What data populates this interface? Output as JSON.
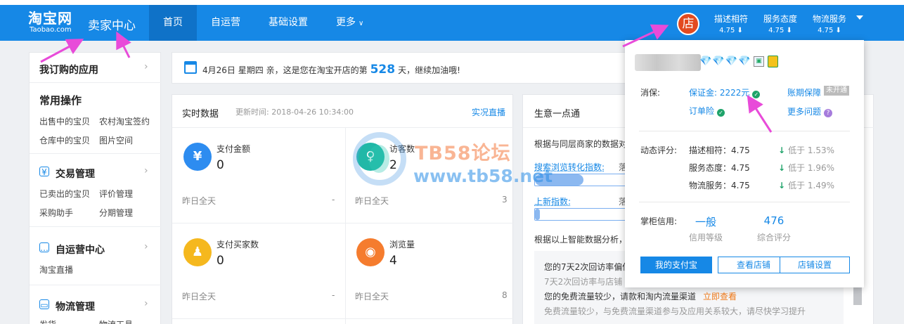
{
  "header": {
    "logo_cn": "淘宝网",
    "logo_en": "Taobao.com",
    "center_title": "卖家中心",
    "nav": [
      {
        "label": "首页",
        "active": true
      },
      {
        "label": "自运营"
      },
      {
        "label": "基础设置"
      },
      {
        "label": "更多",
        "has_dropdown": true
      }
    ],
    "shop_avatar": "店",
    "ratings": [
      {
        "label": "描述相符",
        "value": "4.75 ⬇"
      },
      {
        "label": "服务态度",
        "value": "4.75 ⬇"
      },
      {
        "label": "物流服务",
        "value": "4.75 ⬇"
      }
    ]
  },
  "sidebar": {
    "subscribed_apps": "我订购的应用",
    "common_ops": {
      "title": "常用操作",
      "links": [
        "出售中的宝贝",
        "农村淘宝签约",
        "仓库中的宝贝",
        "图片空间"
      ]
    },
    "trade": {
      "icon": "yen-icon",
      "title": "交易管理",
      "links": [
        "已卖出的宝贝",
        "评价管理",
        "采购助手",
        "分期管理"
      ]
    },
    "self_op": {
      "icon": "chat-icon",
      "title": "自运营中心",
      "links": [
        "淘宝直播"
      ]
    },
    "logistics": {
      "icon": "truck-icon",
      "title": "物流管理",
      "links": [
        "发货",
        "物流工具"
      ]
    }
  },
  "welcome": {
    "date": "4月26日 星期四",
    "text_before": "亲，这是您在淘宝开店的第",
    "days": "528",
    "text_after": "天，继续加油哦!"
  },
  "realtime": {
    "title": "实时数据",
    "update_time": "更新时间: 2018-04-26 10:34:00",
    "live_link": "实况直播",
    "metrics": [
      {
        "label": "支付金额",
        "value": "0",
        "yesterday": "昨日全天",
        "y_value": "-",
        "icon": "yen-icon",
        "color": "#2d8cf0"
      },
      {
        "label": "访客数",
        "value": "2",
        "yesterday": "昨日全天",
        "y_value": "3",
        "icon": "visitor-icon",
        "color": "#21b8a7"
      },
      {
        "label": "支付买家数",
        "value": "0",
        "yesterday": "昨日全天",
        "y_value": "-",
        "icon": "buyers-icon",
        "color": "#f5b81e"
      },
      {
        "label": "浏览量",
        "value": "4",
        "yesterday": "昨日全天",
        "y_value": "8",
        "icon": "eye-icon",
        "color": "#f57c2e"
      }
    ]
  },
  "business": {
    "title": "生意一点通",
    "desc": "根据与同层商家的数据对",
    "indices": [
      {
        "label": "搜索浏览转化指数:",
        "fill": 0.5,
        "trail": "落"
      },
      {
        "label": "上新指数:",
        "fill": 0.05,
        "trail": "落"
      }
    ],
    "analysis": "根据以上智能数据分析，",
    "tips": [
      {
        "text": "您的7天2次回访率偏低",
        "style": "dark"
      },
      {
        "text": "7天2次回访率与店铺",
        "style": "grey"
      },
      {
        "text": "您的免费流量较少，请款和淘内流量渠道",
        "style": "dark",
        "action": "立即查看"
      },
      {
        "text": "免费流量较少，与免费流量渠道参与及应用关系较大，请尽快学习提升",
        "style": "grey"
      }
    ]
  },
  "watermark": {
    "line1": "TB58论坛",
    "line2": "www.tb58.net"
  },
  "popup": {
    "diamonds": "💎💎💎💎",
    "consumer_guarantee_label": "消保:",
    "deposit": "保证金: 2222元",
    "order_insurance": "订单险",
    "account_guarantee": "账期保障",
    "not_enabled": "未开通",
    "more_questions": "更多问题",
    "dynamic_label": "动态评分:",
    "scores": [
      {
        "label": "描述相符：4.75",
        "compare": "低于 1.53%"
      },
      {
        "label": "服务态度：4.75",
        "compare": "低于 1.96%"
      },
      {
        "label": "物流服务：4.75",
        "compare": "低于 1.49%"
      }
    ],
    "credit_label": "掌柜信用:",
    "credit_level": "一般",
    "credit_level_sub": "信用等级",
    "credit_score": "476",
    "credit_score_sub": "综合评分",
    "buttons": [
      "我的支付宝",
      "查看店铺",
      "店铺设置"
    ]
  }
}
